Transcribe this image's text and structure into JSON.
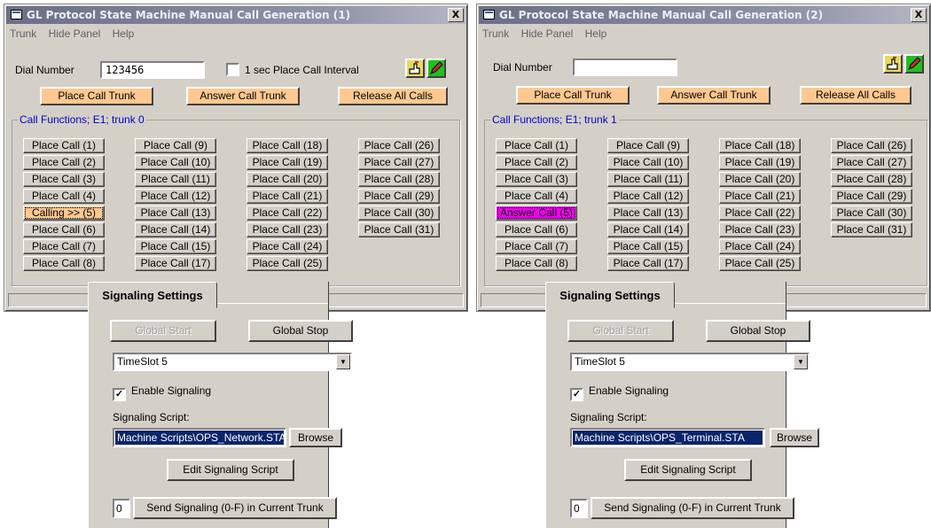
{
  "windows": [
    {
      "title": "GL Protocol State Machine Manual Call Generation (1)",
      "close": "X",
      "menu": [
        "Trunk",
        "Hide Panel",
        "Help"
      ],
      "dial_label": "Dial Number",
      "dial_value": "123456",
      "interval_checkbox": "1 sec Place Call Interval",
      "place_trunk": "Place Call Trunk",
      "answer_trunk": "Answer Call Trunk",
      "release_all": "Release All Calls",
      "group_label": "Call Functions; E1; trunk 0",
      "calls": [
        "Place Call (1)",
        "Place Call (2)",
        "Place Call (3)",
        "Place Call (4)",
        "Calling >> (5)",
        "Place Call (6)",
        "Place Call (7)",
        "Place Call (8)",
        "Place Call (9)",
        "Place Call (10)",
        "Place Call (11)",
        "Place Call (12)",
        "Place Call (13)",
        "Place Call (14)",
        "Place Call (15)",
        "Place Call (17)",
        "Place Call (18)",
        "Place Call (19)",
        "Place Call (20)",
        "Place Call (21)",
        "Place Call (22)",
        "Place Call (23)",
        "Place Call (24)",
        "Place Call (25)",
        "Place Call (26)",
        "Place Call (27)",
        "Place Call (28)",
        "Place Call (29)",
        "Place Call (30)",
        "Place Call (31)"
      ]
    },
    {
      "title": "GL Protocol State Machine Manual Call Generation (2)",
      "close": "X",
      "menu": [
        "Trunk",
        "Hide Panel",
        "Help"
      ],
      "dial_label": "Dial Number",
      "dial_value": "",
      "place_trunk": "Place Call Trunk",
      "answer_trunk": "Answer Call Trunk",
      "release_all": "Release All Calls",
      "group_label": "Call Functions; E1; trunk 1",
      "calls": [
        "Place Call (1)",
        "Place Call (2)",
        "Place Call (3)",
        "Place Call (4)",
        "Answer Call (5)",
        "Place Call (6)",
        "Place Call (7)",
        "Place Call (8)",
        "Place Call (9)",
        "Place Call (10)",
        "Place Call (11)",
        "Place Call (12)",
        "Place Call (13)",
        "Place Call (14)",
        "Place Call (15)",
        "Place Call (17)",
        "Place Call (18)",
        "Place Call (19)",
        "Place Call (20)",
        "Place Call (21)",
        "Place Call (22)",
        "Place Call (23)",
        "Place Call (24)",
        "Place Call (25)",
        "Place Call (26)",
        "Place Call (27)",
        "Place Call (28)",
        "Place Call (29)",
        "Place Call (30)",
        "Place Call (31)"
      ]
    }
  ],
  "panels": [
    {
      "tab": "Signaling Settings",
      "global_start": "Global Start",
      "global_stop": "Global Stop",
      "timeslot": "TimeSlot 5",
      "enable_signaling": "Enable Signaling",
      "script_label": "Signaling Script:",
      "script_path": "Machine Scripts\\OPS_Network.STA",
      "browse": "Browse",
      "edit_script": "Edit Signaling Script",
      "sig_value": "0",
      "send_signaling": "Send Signaling (0-F) in Current Trunk"
    },
    {
      "tab": "Signaling Settings",
      "global_start": "Global Start",
      "global_stop": "Global Stop",
      "timeslot": "TimeSlot 5",
      "enable_signaling": "Enable Signaling",
      "script_label": "Signaling Script:",
      "script_path": "Machine Scripts\\OPS_Terminal.STA",
      "browse": "Browse",
      "edit_script": "Edit Signaling Script",
      "sig_value": "0",
      "send_signaling": "Send Signaling (0-F) in Current Trunk"
    }
  ],
  "icons": {
    "hand": "hand-pointer-icon",
    "pen": "pen-icon"
  },
  "colors": {
    "orange_button": "#ffc890",
    "answer_magenta": "#f000f0",
    "group_label_blue": "#0000c8",
    "selection_blue": "#0a246a"
  }
}
